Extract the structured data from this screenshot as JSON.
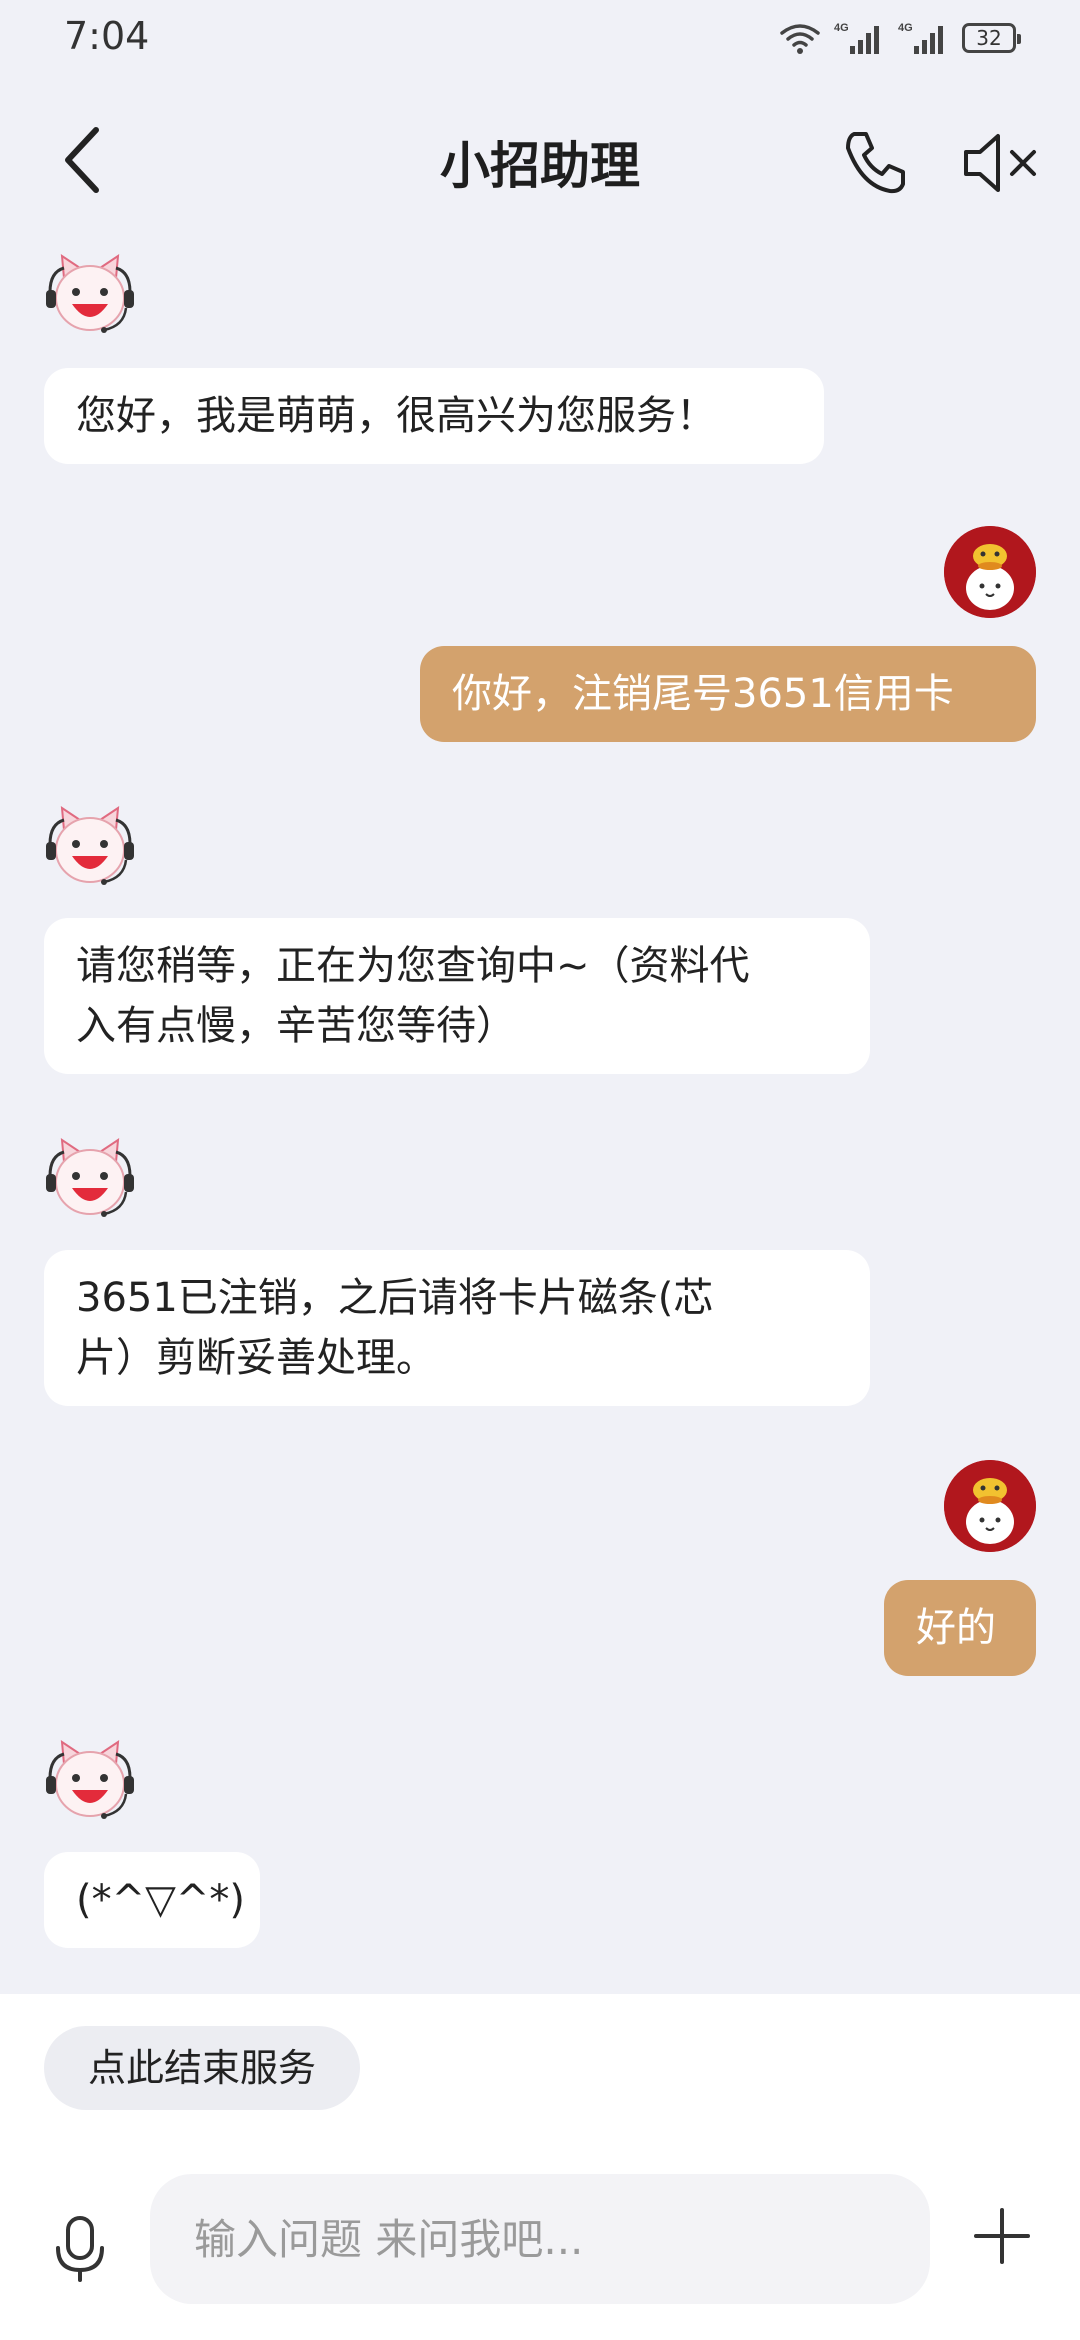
{
  "status_bar": {
    "time": "7:04",
    "battery": "32",
    "network_label": "4G"
  },
  "nav": {
    "title": "小招助理"
  },
  "messages": [
    {
      "sender": "bot",
      "text": "您好，我是萌萌，很高兴为您服务！"
    },
    {
      "sender": "user",
      "text": "你好，注销尾号3651信用卡"
    },
    {
      "sender": "bot",
      "lines": [
        "请您稍等，正在为您查询中~（资料代",
        "入有点慢，辛苦您等待）"
      ]
    },
    {
      "sender": "bot",
      "lines": [
        "3651已注销，之后请将卡片磁条(芯",
        "片）剪断妥善处理。"
      ]
    },
    {
      "sender": "user",
      "text": "好的"
    },
    {
      "sender": "bot",
      "text": "(*^▽^*)"
    }
  ],
  "bottom": {
    "end_service_label": "点此结束服务",
    "input_placeholder": "输入问题 来问我吧..."
  },
  "colors": {
    "background": "#f0f1f7",
    "user_bubble": "#d3a26d",
    "bot_bubble": "#ffffff",
    "user_avatar": "#b1171d"
  }
}
